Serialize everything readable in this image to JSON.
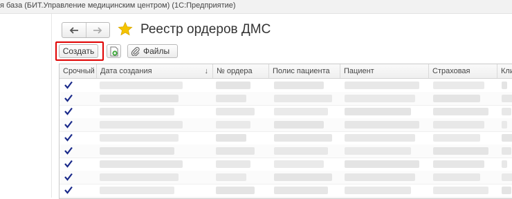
{
  "window": {
    "title": "я база (БИТ.Управление медицинским центром)  (1С:Предприятие)"
  },
  "form": {
    "title": "Реестр ордеров ДМС",
    "nav": {
      "back_icon": "arrow-left-icon",
      "forward_icon": "arrow-right-icon"
    },
    "favorite_icon": "star-icon",
    "favorite_color": "#f5c400",
    "highlight_color": "#e00000"
  },
  "toolbar": {
    "create_label": "Создать",
    "add_icon": "add-document-icon",
    "files_icon": "paperclip-icon",
    "files_label": "Файлы"
  },
  "table": {
    "columns": [
      "Срочный",
      "Дата создания",
      "№ ордера",
      "Полис пациента",
      "Пациент",
      "Страховая",
      "Кли"
    ],
    "sort_indicator": "↓",
    "check_color": "#1a2a8a",
    "rows": [
      {
        "urgent": true
      },
      {
        "urgent": true
      },
      {
        "urgent": true
      },
      {
        "urgent": true
      },
      {
        "urgent": true
      },
      {
        "urgent": true
      },
      {
        "urgent": true
      },
      {
        "urgent": true
      },
      {
        "urgent": true
      }
    ]
  }
}
